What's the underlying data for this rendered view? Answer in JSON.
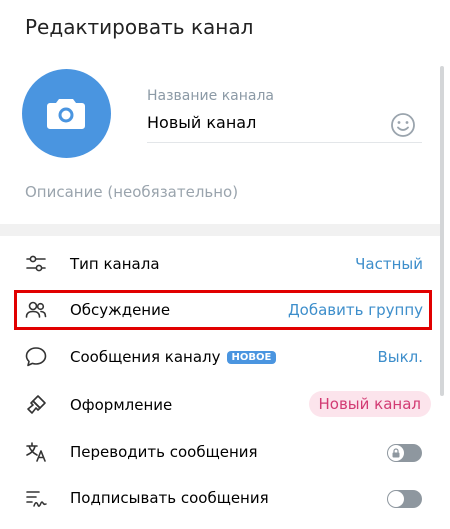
{
  "title": "Редактировать канал",
  "name_field": {
    "label": "Название канала",
    "value": "Новый канал"
  },
  "description_placeholder": "Описание (необязательно)",
  "rows": [
    {
      "label": "Тип канала",
      "value": "Частный",
      "icon": "settings-sliders-icon"
    },
    {
      "label": "Обсуждение",
      "value": "Добавить группу",
      "icon": "users-icon"
    },
    {
      "label": "Сообщения каналу",
      "badge": "НОВОЕ",
      "value": "Выкл.",
      "icon": "chat-bubble-icon"
    },
    {
      "label": "Оформление",
      "value": "Новый канал",
      "icon": "brush-icon"
    },
    {
      "label": "Переводить сообщения",
      "toggle": "off-locked",
      "icon": "translate-icon"
    },
    {
      "label": "Подписывать сообщения",
      "toggle": "off",
      "icon": "signature-icon"
    }
  ],
  "colors": {
    "accent": "#3d8ecb",
    "avatar": "#4a95e0",
    "highlight_border": "#e10000",
    "pill_bg": "#fce4ec",
    "pill_text": "#d23b73"
  }
}
